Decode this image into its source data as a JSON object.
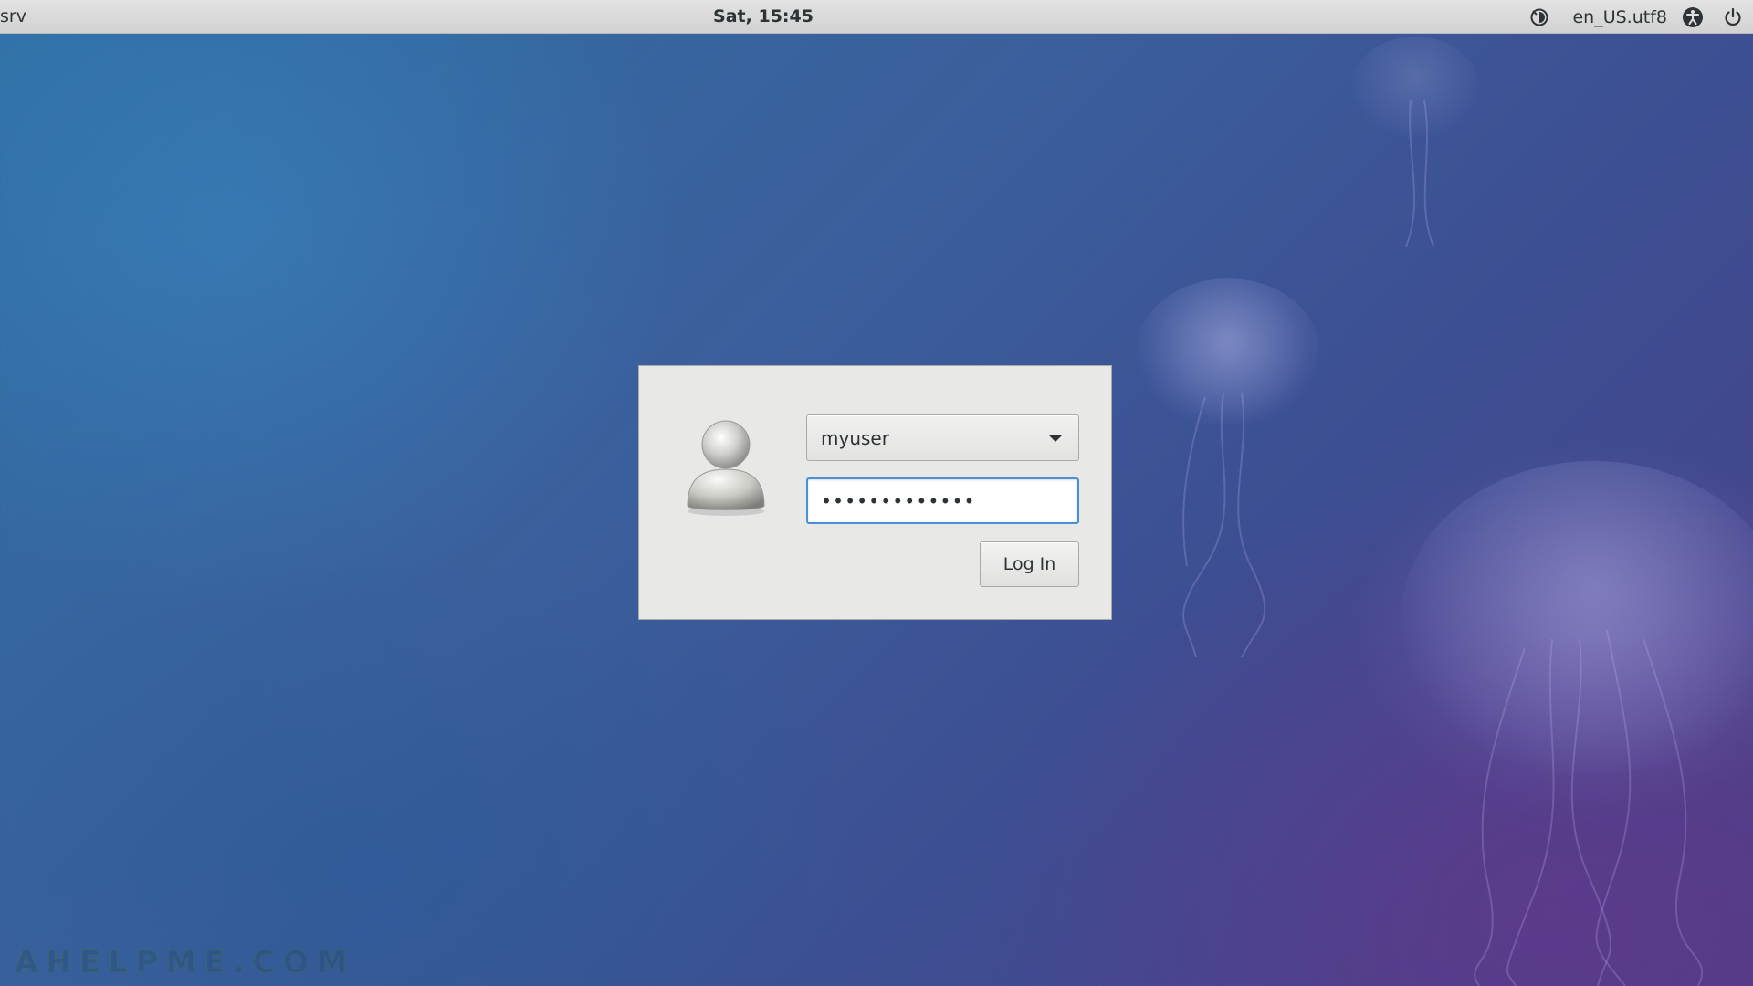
{
  "topbar": {
    "hostname": "srv",
    "clock": "Sat, 15:45",
    "locale": "en_US.utf8",
    "icons": [
      "session-icon",
      "accessibility-icon",
      "power-icon"
    ]
  },
  "login": {
    "avatar_icon": "user-avatar-icon",
    "selected_user": "myuser",
    "password_masked": "•••••••••••••",
    "login_button": "Log In"
  },
  "watermark": "AHELPME.COM",
  "colors": {
    "topbar_bg": "#d9d9d9",
    "dialog_bg": "#e8e8e7",
    "focus_border": "#4a90d9",
    "text": "#2e3436"
  }
}
